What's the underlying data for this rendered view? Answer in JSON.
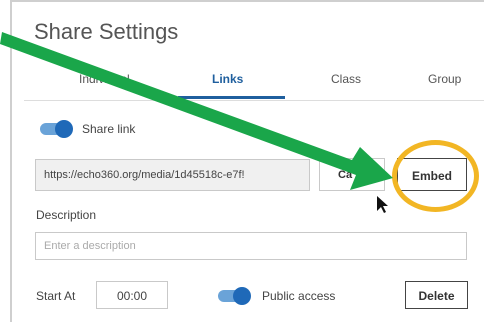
{
  "title": "Share Settings",
  "tabs": [
    {
      "label": "Individual",
      "active": false
    },
    {
      "label": "Links",
      "active": true
    },
    {
      "label": "Class",
      "active": false
    },
    {
      "label": "Group",
      "active": false
    }
  ],
  "share_link": {
    "label": "Share link",
    "on": true
  },
  "link": {
    "value": "https://echo360.org/media/1d45518c-e7f!"
  },
  "copy_button": {
    "label": "Ca"
  },
  "embed_button": {
    "label": "Embed"
  },
  "description": {
    "label": "Description",
    "placeholder": "Enter a description"
  },
  "start_at": {
    "label": "Start At",
    "value": "00:00"
  },
  "public_access": {
    "label": "Public access",
    "on": true
  },
  "delete_button": {
    "label": "Delete"
  },
  "colors": {
    "accent": "#1f5f9e",
    "toggle": "#1f69b8",
    "arrow": "#1aa64a",
    "highlight": "#f2b624"
  }
}
